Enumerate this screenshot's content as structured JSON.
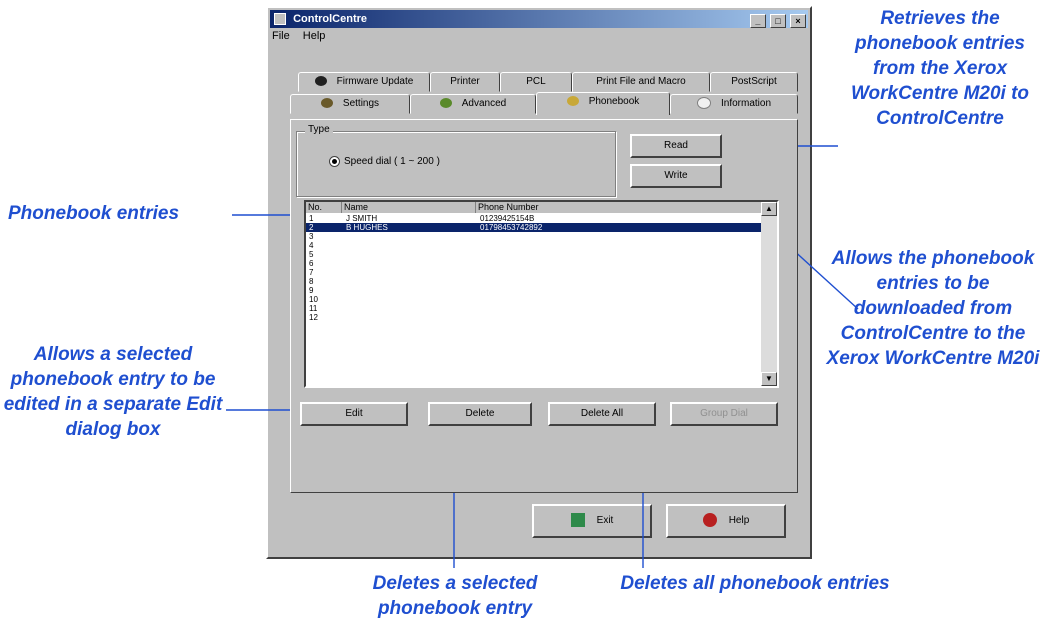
{
  "window": {
    "title": "ControlCentre",
    "controls": [
      "_",
      "□",
      "×"
    ],
    "menu": [
      "File",
      "Help"
    ]
  },
  "tabs": {
    "row1": [
      "Firmware Update",
      "Printer",
      "PCL",
      "Print File and Macro",
      "PostScript"
    ],
    "row2": [
      "Settings",
      "Advanced",
      "Phonebook",
      "Information"
    ],
    "active": "Phonebook"
  },
  "type_group": {
    "legend": "Type",
    "option": "Speed dial ( 1 ~ 200 )"
  },
  "buttons": {
    "read": "Read",
    "write": "Write",
    "edit": "Edit",
    "delete": "Delete",
    "delete_all": "Delete All",
    "disabled": "Group Dial",
    "exit": "Exit",
    "help": "Help"
  },
  "phonebook_list": {
    "columns": [
      "No.",
      "Name",
      "Phone Number"
    ],
    "rows": [
      {
        "no": "1",
        "name": "J SMITH",
        "phone": "01239425154B"
      },
      {
        "no": "2",
        "name": "B HUGHES",
        "phone": "01798453742892"
      },
      {
        "no": "3",
        "name": "",
        "phone": ""
      },
      {
        "no": "4",
        "name": "",
        "phone": ""
      },
      {
        "no": "5",
        "name": "",
        "phone": ""
      },
      {
        "no": "6",
        "name": "",
        "phone": ""
      },
      {
        "no": "7",
        "name": "",
        "phone": ""
      },
      {
        "no": "8",
        "name": "",
        "phone": ""
      },
      {
        "no": "9",
        "name": "",
        "phone": ""
      },
      {
        "no": "10",
        "name": "",
        "phone": ""
      },
      {
        "no": "11",
        "name": "",
        "phone": ""
      },
      {
        "no": "12",
        "name": "",
        "phone": ""
      }
    ],
    "selected_row": 2
  },
  "callouts": {
    "retrieves": "Retrieves the phonebook entries from the Xerox WorkCentre M20i to ControlCentre",
    "entries": "Phonebook entries",
    "allows_download": "Allows the phonebook entries to be downloaded from ControlCentre to the Xerox WorkCentre M20i",
    "allows_edit": "Allows a selected phonebook entry to be edited in a separate Edit dialog box",
    "deletes_selected": "Deletes a selected phonebook entry",
    "deletes_all": "Deletes all phonebook entries"
  },
  "colors": {
    "callout_text": "#1f4fd0",
    "leader_line": "#1f4fd0",
    "selection": "#0a246a",
    "window_face": "#c0c0c0"
  }
}
